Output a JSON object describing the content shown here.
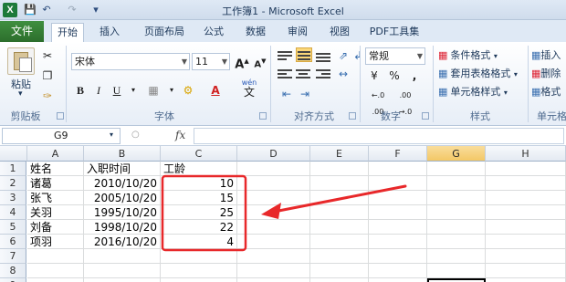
{
  "window": {
    "title": "工作簿1 - Microsoft Excel",
    "app_icon": "X",
    "qat": [
      "save-icon",
      "undo-icon",
      "redo-icon",
      "customize-icon"
    ]
  },
  "ribbon": {
    "file_tab": "文件",
    "tabs": [
      {
        "label": "开始",
        "active": true
      },
      {
        "label": "插入"
      },
      {
        "label": "页面布局"
      },
      {
        "label": "公式"
      },
      {
        "label": "数据"
      },
      {
        "label": "审阅"
      },
      {
        "label": "视图"
      },
      {
        "label": "PDF工具集"
      }
    ],
    "clipboard": {
      "paste": "粘贴",
      "label": "剪贴板"
    },
    "font": {
      "name": "宋体",
      "size": "11",
      "bold": "B",
      "italic": "I",
      "underline": "U",
      "grow": "A",
      "shrink": "A",
      "wen": "wén",
      "wen_char": "文",
      "label": "字体"
    },
    "alignment": {
      "label": "对齐方式"
    },
    "number": {
      "format": "常规",
      "currency": "¥",
      "percent": "%",
      "comma": ",",
      "inc_dec": "←.0 .00",
      "dec_dec": ".00 →.0",
      "label": "数字"
    },
    "styles": {
      "conditional": "条件格式",
      "table": "套用表格格式",
      "cell": "单元格样式",
      "label": "样式"
    },
    "cells": {
      "insert": "插入",
      "delete": "删除",
      "format": "格式",
      "label": "单元格"
    }
  },
  "formula_bar": {
    "name_box": "G9",
    "fx": "fx",
    "value": ""
  },
  "sheet": {
    "columns": [
      "A",
      "B",
      "C",
      "D",
      "E",
      "F",
      "G",
      "H"
    ],
    "selected_column": "G",
    "rows": [
      {
        "n": "1",
        "A": "姓名",
        "B": "入职时间",
        "C": "工龄"
      },
      {
        "n": "2",
        "A": "诸葛",
        "B": "2010/10/20",
        "C": "10"
      },
      {
        "n": "3",
        "A": "张飞",
        "B": "2005/10/20",
        "C": "15"
      },
      {
        "n": "4",
        "A": "关羽",
        "B": "1995/10/20",
        "C": "25"
      },
      {
        "n": "5",
        "A": "刘备",
        "B": "1998/10/20",
        "C": "22"
      },
      {
        "n": "6",
        "A": "项羽",
        "B": "2016/10/20",
        "C": "4"
      },
      {
        "n": "7",
        "A": "",
        "B": "",
        "C": ""
      },
      {
        "n": "8",
        "A": "",
        "B": "",
        "C": ""
      },
      {
        "n": "9",
        "A": "",
        "B": "",
        "C": ""
      }
    ]
  },
  "annotation": {
    "color": "#e8282a"
  }
}
